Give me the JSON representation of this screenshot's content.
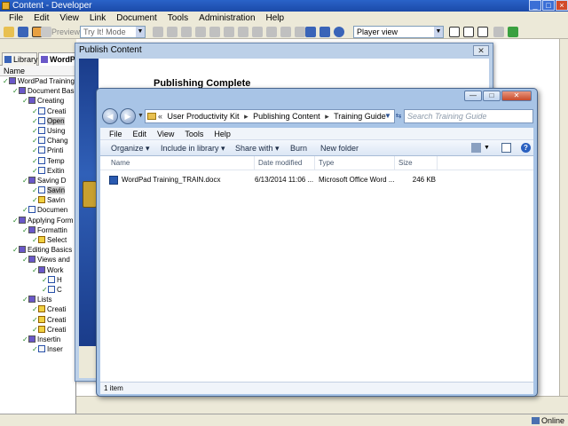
{
  "app": {
    "title": "Content - Developer",
    "menu": [
      "File",
      "Edit",
      "View",
      "Link",
      "Document",
      "Tools",
      "Administration",
      "Help"
    ],
    "toolbar": {
      "preview_label": "Preview",
      "mode_select": "Try It! Mode",
      "view_select": "Player view"
    },
    "tabs": {
      "library": "Library",
      "outline": "WordP"
    },
    "tree_header": "Name",
    "tree": [
      {
        "label": "WordPad Training",
        "indent": 0,
        "icon": "book"
      },
      {
        "label": "Document Basics",
        "indent": 1,
        "icon": "book"
      },
      {
        "label": "Creating",
        "indent": 2,
        "icon": "book"
      },
      {
        "label": "Creati",
        "indent": 3,
        "icon": "topic"
      },
      {
        "label": "Open",
        "indent": 3,
        "icon": "topic",
        "selected": true
      },
      {
        "label": "Using",
        "indent": 3,
        "icon": "topic"
      },
      {
        "label": "Chang",
        "indent": 3,
        "icon": "topic"
      },
      {
        "label": "Printi",
        "indent": 3,
        "icon": "topic"
      },
      {
        "label": "Temp",
        "indent": 3,
        "icon": "topic"
      },
      {
        "label": "Exitin",
        "indent": 3,
        "icon": "topic"
      },
      {
        "label": "Saving D",
        "indent": 2,
        "icon": "book"
      },
      {
        "label": "Savin",
        "indent": 3,
        "icon": "topic",
        "selected": true
      },
      {
        "label": "Savin",
        "indent": 3,
        "icon": "quest"
      },
      {
        "label": "Documen",
        "indent": 2,
        "icon": "topic"
      },
      {
        "label": "Applying Form",
        "indent": 1,
        "icon": "book"
      },
      {
        "label": "Formattin",
        "indent": 2,
        "icon": "book"
      },
      {
        "label": "Select",
        "indent": 3,
        "icon": "quest"
      },
      {
        "label": "Editing Basics",
        "indent": 1,
        "icon": "book"
      },
      {
        "label": "Views and",
        "indent": 2,
        "icon": "book"
      },
      {
        "label": "Work",
        "indent": 3,
        "icon": "book"
      },
      {
        "label": "H",
        "indent": 4,
        "icon": "topic"
      },
      {
        "label": "C",
        "indent": 4,
        "icon": "topic"
      },
      {
        "label": "Lists",
        "indent": 2,
        "icon": "book"
      },
      {
        "label": "Creati",
        "indent": 3,
        "icon": "quest"
      },
      {
        "label": "Creati",
        "indent": 3,
        "icon": "quest"
      },
      {
        "label": "Creati",
        "indent": 3,
        "icon": "quest"
      },
      {
        "label": "Insertin",
        "indent": 2,
        "icon": "book"
      },
      {
        "label": "Inser",
        "indent": 3,
        "icon": "topic"
      }
    ],
    "status": {
      "online": "Online"
    }
  },
  "publish_dialog": {
    "title": "Publish Content",
    "close_label": "✕",
    "heading": "Publishing Complete"
  },
  "explorer": {
    "address": [
      "User Productivity Kit",
      "Publishing Content",
      "Training Guide"
    ],
    "search_placeholder": "Search Training Guide",
    "menu": [
      "File",
      "Edit",
      "View",
      "Tools",
      "Help"
    ],
    "commands": [
      "Organize ▾",
      "Include in library ▾",
      "Share with ▾",
      "Burn",
      "New folder"
    ],
    "columns": [
      "Name",
      "Date modified",
      "Type",
      "Size"
    ],
    "files": [
      {
        "name": "WordPad Training_TRAIN.docx",
        "date": "6/13/2014 11:06 ...",
        "type": "Microsoft Office Word ...",
        "size": "246 KB"
      }
    ],
    "status": "1 item"
  },
  "colors": {
    "xp_title": "#2a63c8",
    "explorer_frame": "#a8c4e6",
    "check_green": "#2a8a2a"
  }
}
